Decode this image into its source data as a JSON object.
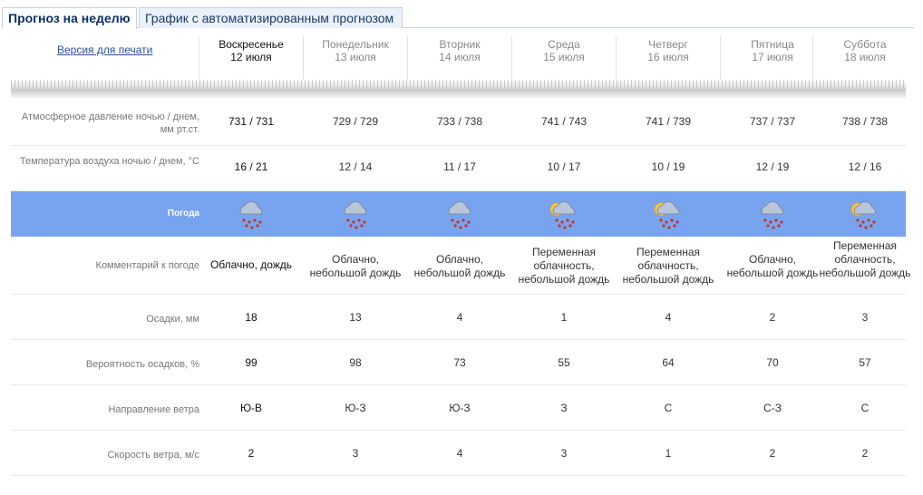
{
  "tabs": [
    {
      "label": "Прогноз на неделю"
    },
    {
      "label": "График с автоматизированным прогнозом"
    }
  ],
  "print_link": "Версия для печати",
  "days": [
    {
      "name": "Воскресенье",
      "date": "12 июля"
    },
    {
      "name": "Понедельник",
      "date": "13 июля"
    },
    {
      "name": "Вторник",
      "date": "14 июля"
    },
    {
      "name": "Среда",
      "date": "15 июля"
    },
    {
      "name": "Четверг",
      "date": "16 июля"
    },
    {
      "name": "Пятница",
      "date": "17 июля"
    },
    {
      "name": "Суббота",
      "date": "18 июля"
    }
  ],
  "labels": {
    "pressure": "Атмосферное давление ночью / днем, мм рт.ст.",
    "temperature": "Температура воздуха ночью / днем, °С",
    "weather": "Погода",
    "comment": "Комментарий к погоде",
    "precip": "Осадки, мм",
    "precip_prob": "Вероятность осадков, %",
    "wind_dir": "Направление ветра",
    "wind_speed": "Скорость ветра, м/с"
  },
  "pressure": [
    "731 / 731",
    "729 / 729",
    "733 / 738",
    "741 / 743",
    "741 / 739",
    "737 / 737",
    "738 / 738"
  ],
  "temperature": [
    "16 / 21",
    "12 / 14",
    "11 / 17",
    "10 / 17",
    "10 / 19",
    "12 / 19",
    "12 / 16"
  ],
  "weather_icons": [
    "rain-cloud-icon",
    "rain-cloud-icon",
    "rain-cloud-icon",
    "partly-cloudy-rain-icon",
    "partly-cloudy-rain-icon",
    "rain-cloud-icon",
    "partly-cloudy-rain-icon"
  ],
  "comment": [
    "Облачно, дождь",
    "Облачно, небольшой дождь",
    "Облачно, небольшой дождь",
    "Переменная облачность, небольшой дождь",
    "Переменная облачность, небольшой дождь",
    "Облачно, небольшой дождь",
    "Переменная облачность, небольшой дождь"
  ],
  "precip": [
    "18",
    "13",
    "4",
    "1",
    "4",
    "2",
    "3"
  ],
  "precip_prob": [
    "99",
    "98",
    "73",
    "55",
    "64",
    "70",
    "57"
  ],
  "wind_dir": [
    "Ю-В",
    "Ю-З",
    "Ю-З",
    "З",
    "С",
    "С-З",
    "С"
  ],
  "wind_speed": [
    "2",
    "3",
    "4",
    "3",
    "1",
    "2",
    "2"
  ],
  "colors": {
    "weather_band": "#78a3ef",
    "tab_border": "#c5d3e3",
    "link": "#2a4f9c"
  }
}
